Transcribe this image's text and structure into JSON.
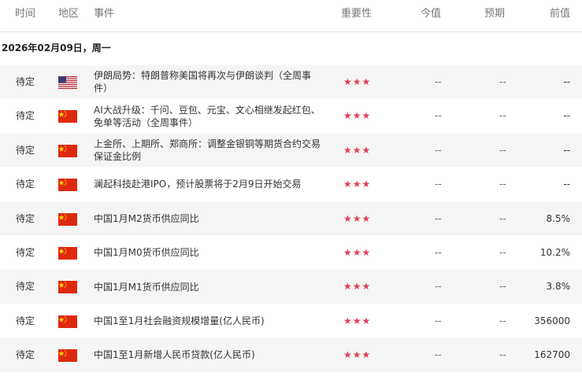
{
  "header": {
    "time": "时间",
    "region": "地区",
    "event": "事件",
    "importance": "重要性",
    "actual": "今值",
    "forecast": "预期",
    "previous": "前值"
  },
  "date_label": "2026年02月09日，周一",
  "importance_color": "#e23c55",
  "rows": [
    {
      "time": "待定",
      "flag": "us-flag-icon",
      "event": "伊朗局势：特朗普称美国将再次与伊朗谈判（全周事件）",
      "importance": "★★★",
      "actual": "--",
      "forecast": "--",
      "previous": "--"
    },
    {
      "time": "待定",
      "flag": "china-flag-icon",
      "event": "AI大战升级：千问、豆包、元宝、文心相继发起红包、免单等活动（全周事件）",
      "importance": "★★★",
      "actual": "--",
      "forecast": "--",
      "previous": "--"
    },
    {
      "time": "待定",
      "flag": "china-flag-icon",
      "event": "上金所、上期所、郑商所：调整金银铜等期货合约交易保证金比例",
      "importance": "★★★",
      "actual": "--",
      "forecast": "--",
      "previous": "--"
    },
    {
      "time": "待定",
      "flag": "china-flag-icon",
      "event": "澜起科技赴港IPO，预计股票将于2月9日开始交易",
      "importance": "★★★",
      "actual": "--",
      "forecast": "--",
      "previous": "--"
    },
    {
      "time": "待定",
      "flag": "china-flag-icon",
      "event": "中国1月M2货币供应同比",
      "importance": "★★★",
      "actual": "--",
      "forecast": "--",
      "previous": "8.5%"
    },
    {
      "time": "待定",
      "flag": "china-flag-icon",
      "event": "中国1月M0货币供应同比",
      "importance": "★★★",
      "actual": "--",
      "forecast": "--",
      "previous": "10.2%"
    },
    {
      "time": "待定",
      "flag": "china-flag-icon",
      "event": "中国1月M1货币供应同比",
      "importance": "★★★",
      "actual": "--",
      "forecast": "--",
      "previous": "3.8%"
    },
    {
      "time": "待定",
      "flag": "china-flag-icon",
      "event": "中国1至1月社会融资规模增量(亿人民币)",
      "importance": "★★★",
      "actual": "--",
      "forecast": "--",
      "previous": "356000"
    },
    {
      "time": "待定",
      "flag": "china-flag-icon",
      "event": "中国1至1月新增人民币贷款(亿人民币)",
      "importance": "★★★",
      "actual": "--",
      "forecast": "--",
      "previous": "162700"
    }
  ]
}
